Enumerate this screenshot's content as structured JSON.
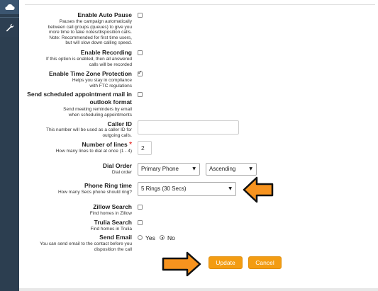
{
  "sidebar": {
    "top_icon": "cloud-icon",
    "tool_icon": "wrench-icon"
  },
  "form": {
    "enable_auto_pause": {
      "label": "Enable Auto Pause",
      "help": "Pauses the campaign automatically\nbetween call groups (queues) to give you\nmore time to take notes/disposition calls.\nNote: Recommended for first time users,\nbut will slow down calling speed.",
      "checked": false
    },
    "enable_recording": {
      "label": "Enable Recording",
      "help": "If this option is enabled, then all answered\ncalls will be recorded",
      "checked": false
    },
    "enable_time_zone": {
      "label": "Enable Time Zone Protection",
      "help": "Helps you stay in compliance\nwith FTC regulations",
      "checked": true
    },
    "send_appointment": {
      "label_line1": "Send scheduled appointment mail in",
      "label_line2": "outlook format",
      "help": "Send meeting reminders by email\nwhen scheduling appointments",
      "checked": false
    },
    "caller_id": {
      "label": "Caller ID",
      "help": "This number will be used as a caller ID for\noutgoing calls.",
      "value": ""
    },
    "number_of_lines": {
      "label": "Number of lines",
      "required_mark": "*",
      "help": "How many lines to dial at once (1 - 4)",
      "value": "2"
    },
    "dial_order": {
      "label": "Dial Order",
      "help": "Dial order",
      "field_value": "Primary Phone",
      "sort_value": "Ascending"
    },
    "ring_time": {
      "label": "Phone Ring time",
      "help": "How many Secs phone should ring?",
      "value": "5 Rings (30 Secs)"
    },
    "zillow_search": {
      "label": "Zillow Search",
      "help": "Find homes in Zillow",
      "checked": false
    },
    "trulia_search": {
      "label": "Trulia Search",
      "help": "Find homes in Trulia",
      "checked": false
    },
    "send_email": {
      "label": "Send Email",
      "help": "You can send email to the contact before you\ndisposition the call",
      "option_yes": "Yes",
      "option_no": "No",
      "selected": "No"
    }
  },
  "actions": {
    "update_label": "Update",
    "cancel_label": "Cancel"
  },
  "colors": {
    "accent": "#f39c12",
    "arrow_fill": "#f7931e",
    "sidebar": "#2c3e50"
  }
}
